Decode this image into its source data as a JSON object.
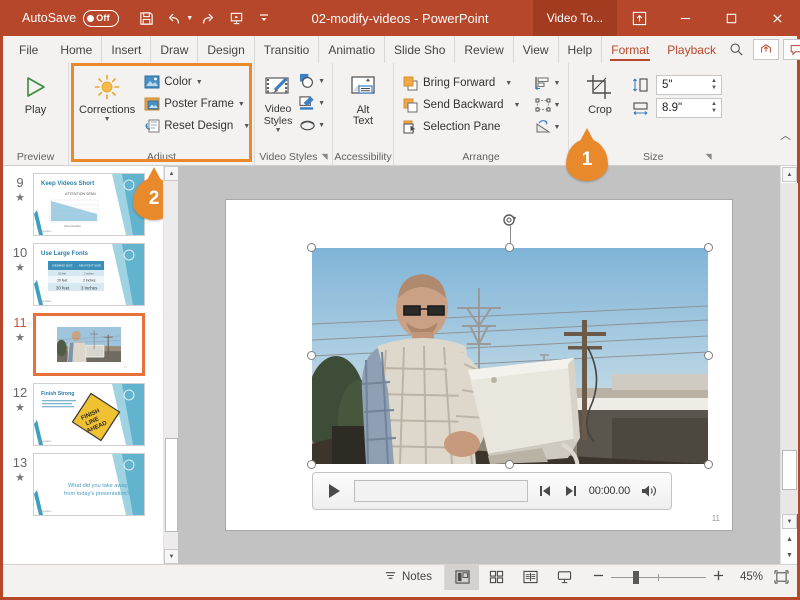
{
  "titlebar": {
    "autosave_label": "AutoSave",
    "autosave_state": "Off",
    "document_title": "02-modify-videos  -  PowerPoint",
    "contextual_tab": "Video To...",
    "qat": [
      {
        "name": "save-icon",
        "label": "Save"
      },
      {
        "name": "undo-icon",
        "label": "Undo"
      },
      {
        "name": "redo-icon",
        "label": "Redo"
      },
      {
        "name": "start-slideshow-icon",
        "label": "Start From Beginning"
      },
      {
        "name": "customize-qat-icon",
        "label": "Customize Quick Access Toolbar"
      }
    ],
    "ribbon_display_label": "Ribbon Display Options",
    "minimize_label": "Minimize",
    "restore_label": "Restore",
    "close_label": "Close"
  },
  "tabs": [
    {
      "label": "File",
      "active": false
    },
    {
      "label": "Home",
      "active": false
    },
    {
      "label": "Insert",
      "active": false
    },
    {
      "label": "Draw",
      "active": false
    },
    {
      "label": "Design",
      "active": false
    },
    {
      "label": "Transitio",
      "active": false
    },
    {
      "label": "Animatio",
      "active": false
    },
    {
      "label": "Slide Sho",
      "active": false
    },
    {
      "label": "Review",
      "active": false
    },
    {
      "label": "View",
      "active": false
    },
    {
      "label": "Help",
      "active": false
    },
    {
      "label": "Format",
      "active": true
    },
    {
      "label": "Playback",
      "active": false
    }
  ],
  "tabstrip_right": {
    "search_label": "Search",
    "share_label": "Share",
    "comments_label": "Comments"
  },
  "ribbon": {
    "preview": {
      "group_title": "Preview",
      "play_label": "Play"
    },
    "adjust": {
      "group_title": "Adjust",
      "corrections_label": "Corrections",
      "items": [
        {
          "label": "Color",
          "icon": "color-icon",
          "has_caret": true
        },
        {
          "label": "Poster Frame",
          "icon": "poster-frame-icon",
          "has_caret": true
        },
        {
          "label": "Reset Design",
          "icon": "reset-design-icon",
          "has_caret": true
        }
      ],
      "highlighted": true,
      "highlight_color": "#e8892b"
    },
    "video_styles": {
      "group_title": "Video Styles",
      "gallery_label": "Video Styles",
      "items": [
        {
          "label": "Video Shape",
          "icon": "video-shape-icon"
        },
        {
          "label": "Video Border",
          "icon": "video-border-icon"
        },
        {
          "label": "Video Effects",
          "icon": "video-effects-icon"
        }
      ]
    },
    "accessibility": {
      "group_title": "Accessibility",
      "alt_text_label": "Alt\nText",
      "alt_text_line1": "Alt",
      "alt_text_line2": "Text"
    },
    "arrange": {
      "group_title": "Arrange",
      "items": [
        {
          "label": "Bring Forward",
          "icon": "bring-forward-icon",
          "has_caret": true
        },
        {
          "label": "Send Backward",
          "icon": "send-backward-icon",
          "has_caret": true
        },
        {
          "label": "Selection Pane",
          "icon": "selection-pane-icon",
          "has_caret": false
        }
      ],
      "mini_items": [
        {
          "label": "Align",
          "icon": "align-icon"
        },
        {
          "label": "Group",
          "icon": "group-icon"
        },
        {
          "label": "Rotate",
          "icon": "rotate-icon"
        }
      ]
    },
    "size": {
      "group_title": "Size",
      "crop_label": "Crop",
      "height_value": "5\"",
      "height_icon_label": "Video Height",
      "width_value": "8.9\"",
      "width_icon_label": "Video Width"
    },
    "collapse_label": "Collapse the Ribbon"
  },
  "callouts": [
    {
      "number": "1"
    },
    {
      "number": "2"
    }
  ],
  "thumbnails": [
    {
      "number": "9",
      "title": "Keep Videos Short",
      "selected": false,
      "kind": "chart"
    },
    {
      "number": "10",
      "title": "Use Large Fonts",
      "selected": false,
      "kind": "table"
    },
    {
      "number": "11",
      "title": "",
      "selected": true,
      "kind": "video"
    },
    {
      "number": "12",
      "title": "Finish Strong",
      "selected": false,
      "kind": "sign",
      "sign_text": "FINISH LINE AHEAD"
    },
    {
      "number": "13",
      "title": "What did you take away from today's presentation?",
      "selected": false,
      "kind": "text"
    }
  ],
  "slide": {
    "slide_number": "11",
    "video": {
      "alt": "Man in plaid shirt holding an old computer monitor outdoors with power lines",
      "controls": {
        "play_label": "Play",
        "back_label": "Move Back",
        "forward_label": "Move Forward",
        "time": "00:00.00",
        "volume_label": "Mute/Unmute"
      }
    }
  },
  "statusbar": {
    "notes_label": "Notes",
    "views": [
      {
        "label": "Normal",
        "icon": "normal-view-icon",
        "active": true
      },
      {
        "label": "Slide Sorter",
        "icon": "slide-sorter-icon",
        "active": false
      },
      {
        "label": "Reading View",
        "icon": "reading-view-icon",
        "active": false
      },
      {
        "label": "Slide Show",
        "icon": "slide-show-icon",
        "active": false
      }
    ],
    "zoom_out_label": "Zoom Out",
    "zoom_in_label": "Zoom In",
    "zoom_percent": "45%",
    "fit_label": "Fit slide to current window"
  },
  "colors": {
    "title_bar": "#b7472a",
    "contextual_tab": "#a23b20",
    "accent_orange": "#e8892b",
    "selection_orange": "#e8703a",
    "ribbon_bg": "#f3f2f1",
    "canvas_bg": "#c2c2c2"
  }
}
